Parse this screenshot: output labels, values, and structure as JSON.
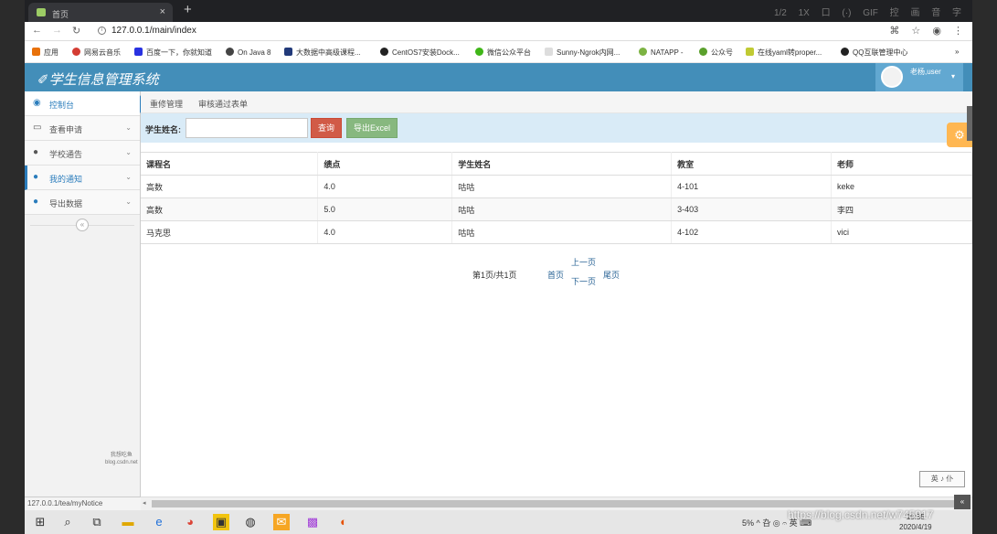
{
  "browser": {
    "tab_title": "首页",
    "tab_close": "×",
    "new_tab": "+",
    "tab_tools": [
      "1/2",
      "1X",
      "口",
      "(·)",
      "GIF",
      "控",
      "画",
      "音",
      "字"
    ],
    "url": "127.0.0.1/main/index",
    "bookmarks": [
      "应用",
      "网易云音乐",
      "百度一下，你就知道",
      "On Java 8",
      "大数据中高级课程...",
      "CentOS7安装Dock...",
      "微信公众平台",
      "Sunny-Ngrok内网...",
      "NATAPP -",
      "公众号",
      "在线yaml转proper...",
      "QQ互联管理中心"
    ],
    "bookmark_more": "»"
  },
  "app": {
    "title": "学生信息管理系统",
    "user_label": "老杨,user",
    "user_caret": "▾"
  },
  "sidebar": {
    "items": [
      {
        "label": "控制台",
        "icon": "dashboard-icon",
        "glyph": "◉"
      },
      {
        "label": "查看申请",
        "icon": "desktop-icon",
        "glyph": "▭"
      },
      {
        "label": "学校通告",
        "icon": "user-icon",
        "glyph": "●"
      },
      {
        "label": "我的通知",
        "icon": "user-icon",
        "glyph": "●"
      },
      {
        "label": "导出数据",
        "icon": "user-icon",
        "glyph": "●"
      }
    ],
    "caret": "⌄",
    "collapse": "«",
    "watermark_line1": "我想吃鱼",
    "watermark_line2": "blog.csdn.net"
  },
  "breadcrumb": [
    "重修管理",
    "审核通过表单"
  ],
  "filter": {
    "label": "学生姓名:",
    "input_value": "",
    "query_button": "查询",
    "export_button": "导出Excel"
  },
  "table": {
    "columns": [
      "课程名",
      "绩点",
      "学生姓名",
      "教室",
      "老师"
    ],
    "rows": [
      [
        "高数",
        "4.0",
        "咕咕",
        "4-101",
        "keke"
      ],
      [
        "高数",
        "5.0",
        "咕咕",
        "3-403",
        "李四"
      ],
      [
        "马克思",
        "4.0",
        "咕咕",
        "4-102",
        "vici"
      ]
    ]
  },
  "pager": {
    "info": "第1页/共1页",
    "first": "首页",
    "prev": "上一页",
    "next": "下一页",
    "last": "尾页"
  },
  "status": {
    "hover_url": "127.0.0.1/tea/myNotice",
    "ime": "英 ♪ 仆",
    "scroll_top": "«"
  },
  "taskbar": {
    "clock_time": "10:35",
    "clock_date": "2020/4/19",
    "sys_tray": "5% ^ 叴 ◎ 𝄐 英 ⌨",
    "watermark": "https://blog.csdn.net/w745917"
  }
}
